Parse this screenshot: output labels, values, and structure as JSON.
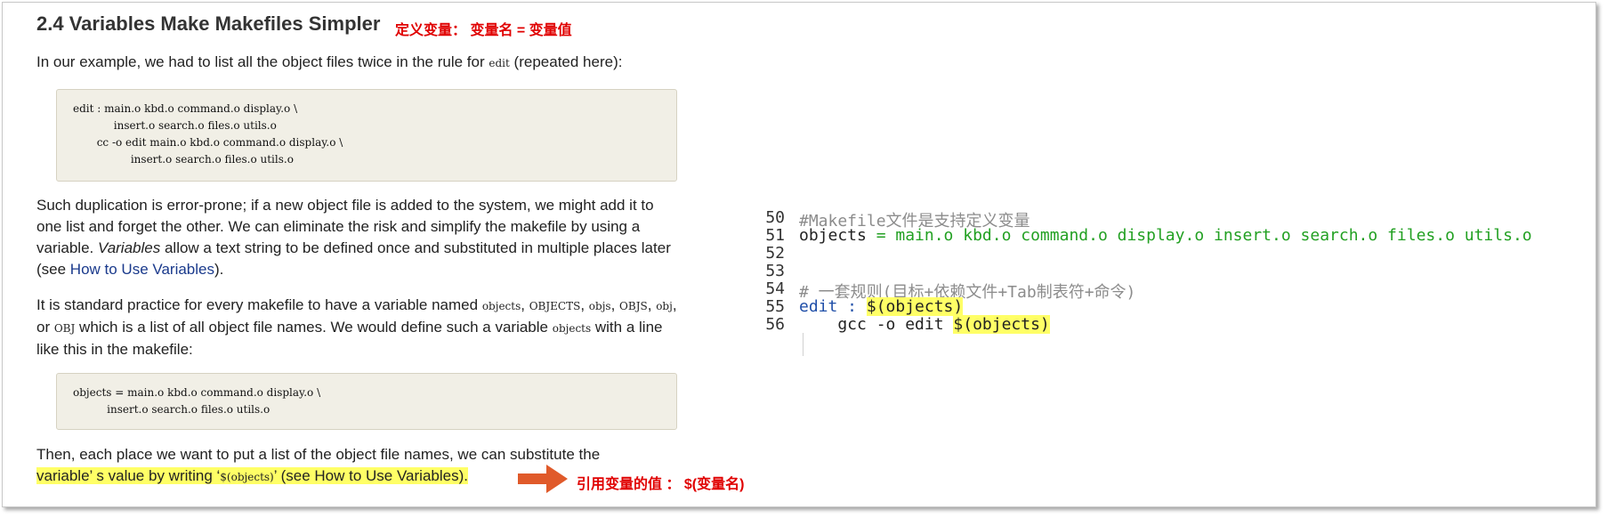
{
  "heading": {
    "title": "2.4 Variables Make Makefiles Simpler",
    "annotation": "定义变量： 变量名 = 变量值"
  },
  "intro": {
    "text_before": "In our example, we had to list all the object files twice in the rule for ",
    "code": "edit",
    "text_after": " (repeated here):"
  },
  "code1": "edit : main.o kbd.o command.o display.o \\\n            insert.o search.o files.o utils.o\n       cc -o edit main.o kbd.o command.o display.o \\\n                 insert.o search.o files.o utils.o",
  "para2": {
    "text_before": "Such duplication is error-prone; if a new object file is added to the system, we might add it to one list and forget the other. We can eliminate the risk and simplify the makefile by using a variable. ",
    "emph": "Variables",
    "text_mid": " allow a text string to be defined once and substituted in multiple places later (see ",
    "link": "How to Use Variables",
    "text_after": ")."
  },
  "para3": {
    "t1": "It is standard practice for every makefile to have a variable named ",
    "c1": "objects",
    "t2": ", ",
    "c2": "OBJECTS",
    "t3": ", ",
    "c3": "objs",
    "t4": ", ",
    "c4": "OBJS",
    "t5": ", ",
    "c5": "obj",
    "t6": ", or ",
    "c6": "OBJ",
    "t7": " which is a list of all object file names. We would define such a variable ",
    "c7": "objects",
    "t8": " with a line like this in the makefile:"
  },
  "code2": "objects = main.o kbd.o command.o display.o \\\n          insert.o search.o files.o utils.o",
  "para4": {
    "line1": "Then, each place we want to put a list of the object file names, we can substitute the",
    "hl_before": "variable’ s value by writing  ‘",
    "hl_code": "$(objects)",
    "hl_after": "’  (see How to Use Variables)."
  },
  "annotation_bottom": "引用变量的值 ：  $(变量名)",
  "editor": {
    "lines": [
      {
        "num": "50",
        "parts": [
          {
            "cls": "cmt",
            "text": "#Makefile文件是支持定义变量"
          }
        ]
      },
      {
        "num": "51",
        "parts": [
          {
            "cls": "",
            "text": "objects "
          },
          {
            "cls": "grn",
            "text": "= main.o kbd.o command.o display.o insert.o search.o files.o utils.o"
          }
        ]
      },
      {
        "num": "52",
        "parts": []
      },
      {
        "num": "53",
        "parts": []
      },
      {
        "num": "54",
        "parts": [
          {
            "cls": "cmt",
            "text": "# 一套规则(目标+依赖文件+Tab制表符+命令)"
          }
        ]
      },
      {
        "num": "55",
        "parts": [
          {
            "cls": "blu",
            "text": "edit : "
          },
          {
            "cls": "hl",
            "text": "$(objects)"
          }
        ]
      },
      {
        "num": "56",
        "parts": [
          {
            "cls": "",
            "text": "    gcc -o edit "
          },
          {
            "cls": "hl",
            "text": "$(objects)"
          }
        ]
      }
    ]
  },
  "colors": {
    "annotation": "#e00000",
    "highlight": "#ffff66",
    "comment": "#8c8c8c",
    "string_green": "#22a022",
    "target_blue": "#1f4ea8",
    "arrow": "#e05a2a",
    "code_bg": "#f1efe6"
  }
}
